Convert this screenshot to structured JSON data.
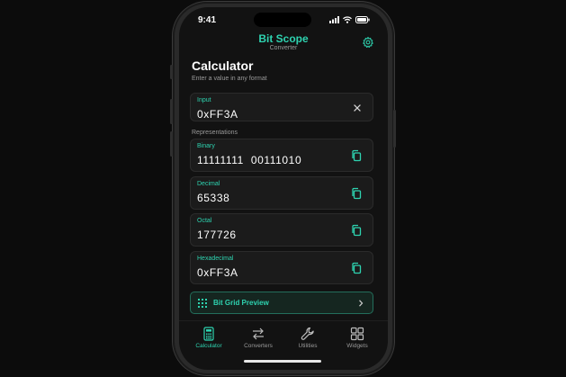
{
  "status": {
    "time": "9:41"
  },
  "header": {
    "title": "Bit Scope",
    "subtitle": "Converter"
  },
  "page": {
    "title": "Calculator",
    "hint": "Enter a value in any format"
  },
  "input": {
    "label": "Input",
    "value": "0xFF3A"
  },
  "representations": {
    "label": "Representations",
    "items": [
      {
        "label": "Binary",
        "value": "11111111  00111010"
      },
      {
        "label": "Decimal",
        "value": "65338"
      },
      {
        "label": "Octal",
        "value": "177726"
      },
      {
        "label": "Hexadecimal",
        "value": "0xFF3A"
      }
    ]
  },
  "bit_grid": {
    "label": "Bit Grid Preview"
  },
  "tabs": [
    {
      "label": "Calculator",
      "icon": "calculator-icon",
      "active": true
    },
    {
      "label": "Converters",
      "icon": "swap-arrows-icon",
      "active": false
    },
    {
      "label": "Utilities",
      "icon": "wrench-icon",
      "active": false
    },
    {
      "label": "Widgets",
      "icon": "widgets-grid-icon",
      "active": false
    }
  ],
  "colors": {
    "accent": "#2ed3b0",
    "background": "#121212",
    "card": "#1b1b1b"
  }
}
